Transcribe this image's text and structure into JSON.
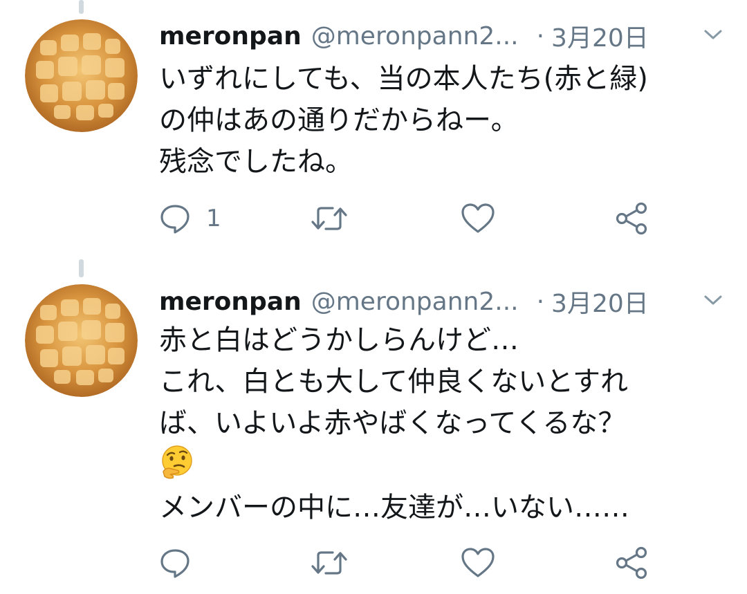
{
  "tweets": [
    {
      "name": "meronpan",
      "handle": "@meronpann2...",
      "dot": "·",
      "date": "3月20日",
      "lines": [
        "いずれにしても、当の本人たち(赤と緑)",
        "の仲はあの通りだからねー。",
        "残念でしたね。"
      ],
      "reply_count": "1",
      "avatar_icon": "melon-pan-avatar"
    },
    {
      "name": "meronpan",
      "handle": "@meronpann2...",
      "dot": "·",
      "date": "3月20日",
      "lines": [
        "赤と白はどうかしらんけど…",
        "これ、白とも大して仲良くないとすれ",
        "ば、いよいよ赤やばくなってくるな？",
        "メンバーの中に…友達が…いない……"
      ],
      "emoji": "thinking-face-emoji",
      "reply_count": "",
      "avatar_icon": "melon-pan-avatar"
    }
  ],
  "icons": {
    "reply": "reply-icon",
    "retweet": "retweet-icon",
    "like": "heart-icon",
    "share": "share-icon",
    "more": "chevron-down-icon"
  },
  "colors": {
    "text": "#14171a",
    "secondary": "#657786",
    "thread_line": "#cfd9de",
    "bread": "#c27a2a"
  }
}
